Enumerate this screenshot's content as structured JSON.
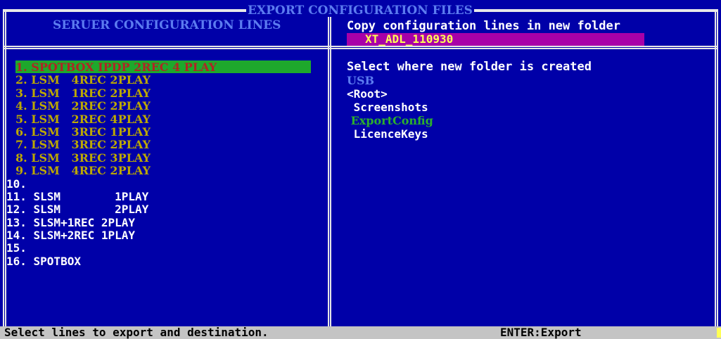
{
  "window": {
    "title": "EXPORT CONFIGURATION FILES"
  },
  "left_panel": {
    "header": "SERUER CONFIGURATION LINES",
    "lines": [
      {
        "text": "1. SPOTBOX IPDP 2REC 4 PLAY",
        "state": "selected"
      },
      {
        "text": "2. LSM   4REC 2PLAY",
        "state": "config"
      },
      {
        "text": "3. LSM   1REC 2PLAY",
        "state": "config"
      },
      {
        "text": "4. LSM   2REC 2PLAY",
        "state": "config"
      },
      {
        "text": "5. LSM   2REC 4PLAY",
        "state": "config"
      },
      {
        "text": "6. LSM   3REC 1PLAY",
        "state": "config"
      },
      {
        "text": "7. LSM   3REC 2PLAY",
        "state": "config"
      },
      {
        "text": "8. LSM   3REC 3PLAY",
        "state": "config"
      },
      {
        "text": "9. LSM   4REC 2PLAY",
        "state": "config"
      },
      {
        "text": "10.",
        "state": "plain"
      },
      {
        "text": "11. SLSM        1PLAY",
        "state": "plain"
      },
      {
        "text": "12. SLSM        2PLAY",
        "state": "plain"
      },
      {
        "text": "13. SLSM+1REC 2PLAY",
        "state": "plain"
      },
      {
        "text": "14. SLSM+2REC 1PLAY",
        "state": "plain"
      },
      {
        "text": "15.",
        "state": "plain"
      },
      {
        "text": "16. SPOTBOX",
        "state": "plain"
      }
    ]
  },
  "right_panel": {
    "copy_label": "Copy configuration lines in new folder",
    "folder_name": "XT_ADL_110930",
    "select_label": "Select where new folder is created",
    "destinations": [
      {
        "text": "USB",
        "state": "device"
      },
      {
        "text": "<Root>",
        "state": "plain"
      },
      {
        "text": " Screenshots",
        "state": "plain"
      },
      {
        "text": " ExportConfig",
        "state": "active"
      },
      {
        "text": " LicenceKeys",
        "state": "plain"
      }
    ]
  },
  "status_bar": {
    "message": "Select lines to export and destination.",
    "hint": "ENTER:Export"
  },
  "colors": {
    "background": "#0000a8",
    "frame": "#e8e8e8",
    "selected_bg": "#1ea82c",
    "config_text": "#bca800",
    "folder_bg": "#a800a8",
    "status_bg": "#c4c4c4"
  }
}
